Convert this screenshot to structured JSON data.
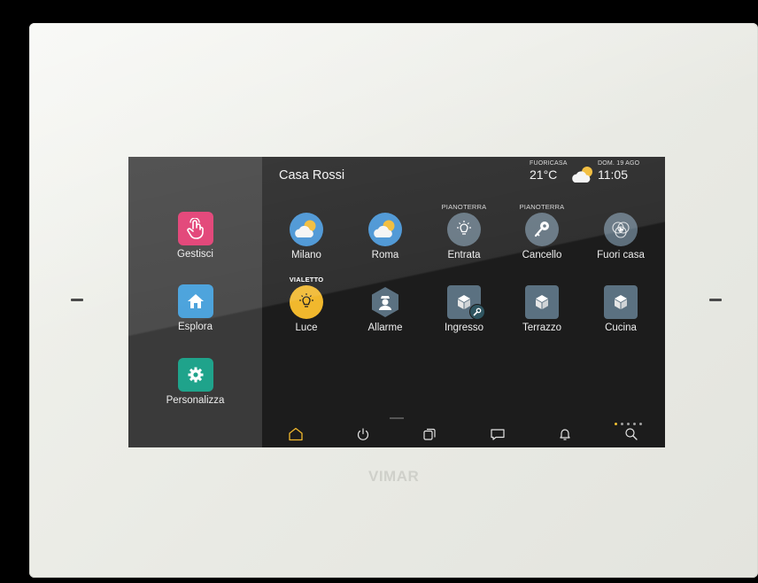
{
  "device": {
    "brand": "VIMAR"
  },
  "header": {
    "home_name": "Casa Rossi",
    "weather": {
      "label": "FUORICASA",
      "temperature": "21°C",
      "icon": "partly-cloudy-icon"
    },
    "datetime": {
      "date": "DOM. 19 AGO",
      "time": "11:05"
    }
  },
  "sidebar": {
    "items": [
      {
        "label": "Gestisci",
        "icon": "hand-touch-icon",
        "color": "#e0336b"
      },
      {
        "label": "Esplora",
        "icon": "home-icon",
        "color": "#3b9ad9"
      },
      {
        "label": "Personalizza",
        "icon": "gear-icon",
        "color": "#1fa38b"
      }
    ]
  },
  "tiles": [
    {
      "caption": "",
      "label": "Milano",
      "icon": "partly-cloudy-icon"
    },
    {
      "caption": "",
      "label": "Roma",
      "icon": "partly-cloudy-icon"
    },
    {
      "caption": "PIANOTERRA",
      "label": "Entrata",
      "icon": "light-bulb-icon"
    },
    {
      "caption": "PIANOTERRA",
      "label": "Cancello",
      "icon": "gate-key-icon"
    },
    {
      "caption": "",
      "label": "Fuori casa",
      "icon": "scenario-play-icon"
    },
    {
      "caption": "VIALETTO",
      "label": "Luce",
      "icon": "light-bulb-on-icon"
    },
    {
      "caption": "",
      "label": "Allarme",
      "icon": "alarm-guard-icon"
    },
    {
      "caption": "",
      "label": "Ingresso",
      "icon": "room-cube-settings-icon"
    },
    {
      "caption": "",
      "label": "Terrazzo",
      "icon": "room-cube-icon"
    },
    {
      "caption": "",
      "label": "Cucina",
      "icon": "room-cube-icon"
    }
  ],
  "pager": {
    "pages": 5,
    "current": 1
  },
  "navbar": {
    "items": [
      {
        "icon": "home-icon",
        "active": true
      },
      {
        "icon": "power-icon",
        "active": false
      },
      {
        "icon": "pages-icon",
        "active": false
      },
      {
        "icon": "message-icon",
        "active": false
      },
      {
        "icon": "bell-icon",
        "active": false
      },
      {
        "icon": "search-icon",
        "active": false
      }
    ]
  },
  "colors": {
    "accent": "#f1b82d",
    "sidebar_bg": "#3a3a3a",
    "screen_bg": "#1c1c1c",
    "tile_blue": "#3f8fd2",
    "tile_grey": "#5b7181"
  }
}
